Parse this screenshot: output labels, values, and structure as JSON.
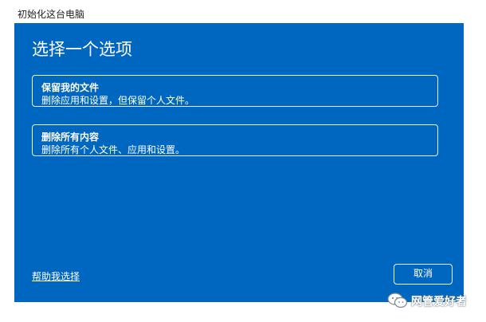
{
  "window": {
    "title": "初始化这台电脑"
  },
  "dialog": {
    "heading": "选择一个选项",
    "options": [
      {
        "title": "保留我的文件",
        "description": "删除应用和设置，但保留个人文件。"
      },
      {
        "title": "删除所有内容",
        "description": "删除所有个人文件、应用和设置。"
      }
    ],
    "help_link": "帮助我选择",
    "cancel_label": "取消"
  },
  "watermark": {
    "text": "网管爱好者",
    "icon": "wechat-icon"
  },
  "colors": {
    "panel_background": "#0067c0",
    "text": "#ffffff"
  }
}
